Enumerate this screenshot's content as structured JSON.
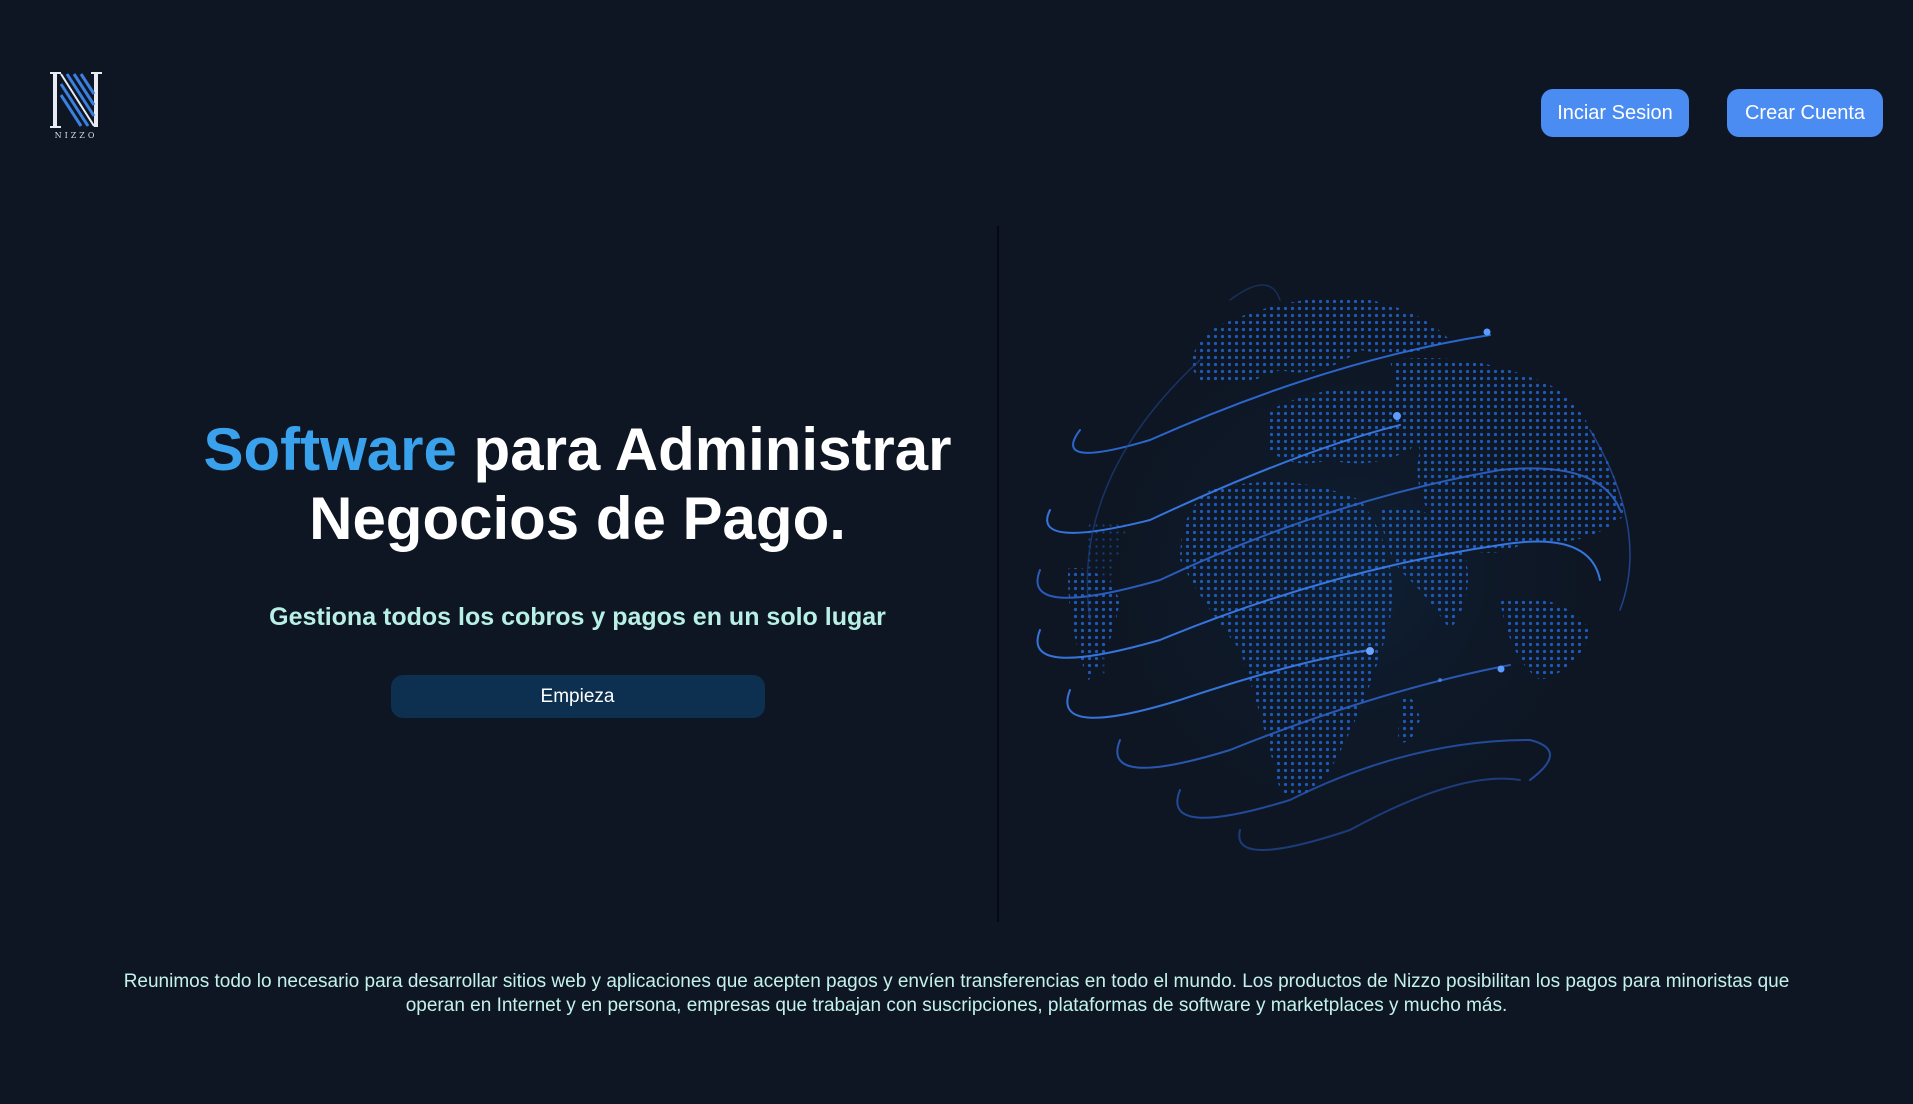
{
  "brand": {
    "logo_text": "NIZZO",
    "accent_color": "#3aa2ec",
    "button_color": "#4a8cf2"
  },
  "nav": {
    "login_label": "Inciar Sesion",
    "signup_label": "Crear Cuenta"
  },
  "hero": {
    "title_highlight": "Software",
    "title_rest": " para Administrar",
    "title_line2": "Negocios de Pago.",
    "subtitle": "Gestiona todos los cobros y pagos en un solo lugar",
    "cta_label": "Empieza",
    "illustration_icon": "globe-icon"
  },
  "description": "Reunimos todo lo necesario para desarrollar sitios web y aplicaciones que acepten pagos y envíen transferencias en todo el mundo. Los productos de Nizzo posibilitan los pagos para minoristas que operan en Internet y en persona, empresas que trabajan con suscripciones, plataformas de software y marketplaces y mucho más."
}
